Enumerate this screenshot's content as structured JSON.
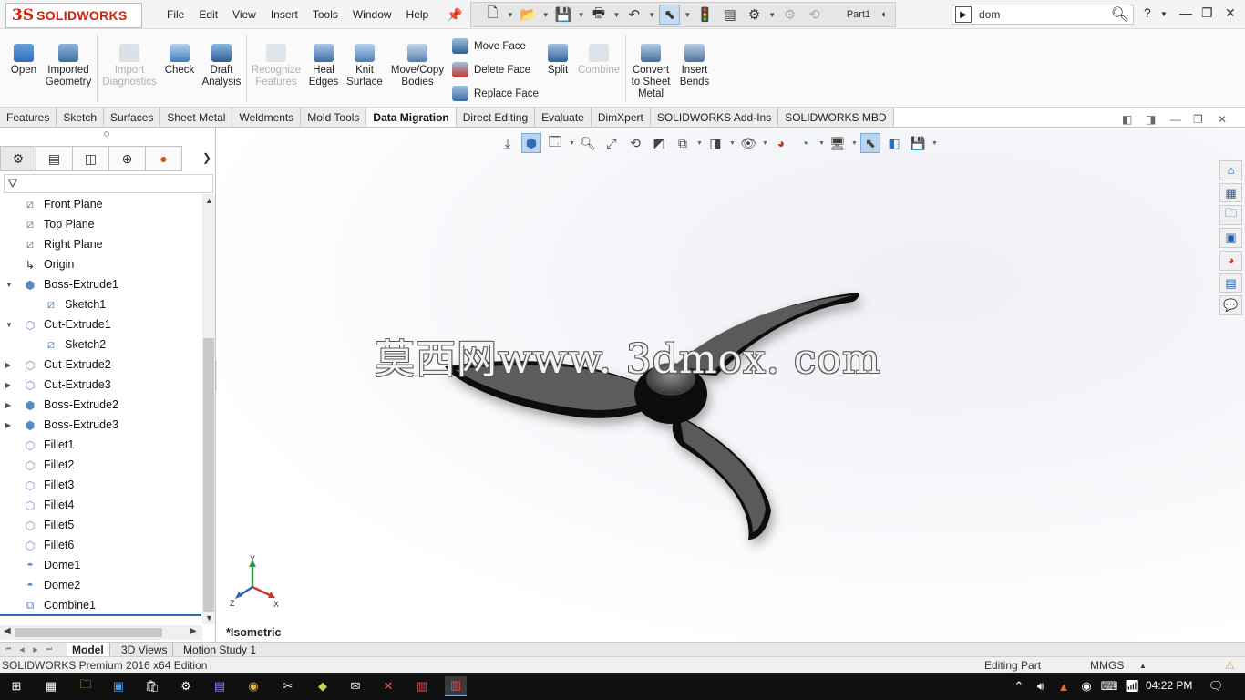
{
  "titlebar": {
    "brand": "SOLIDWORKS",
    "brand_prefix": "3S",
    "menu": [
      "File",
      "Edit",
      "View",
      "Insert",
      "Tools",
      "Window",
      "Help"
    ],
    "doc_name": "Part1",
    "search_value": "dom"
  },
  "ribbon": {
    "open": "Open",
    "imported_geometry_1": "Imported",
    "imported_geometry_2": "Geometry",
    "import_diag_1": "Import",
    "import_diag_2": "Diagnostics",
    "check": "Check",
    "draft_1": "Draft",
    "draft_2": "Analysis",
    "recognize_1": "Recognize",
    "recognize_2": "Features",
    "heal_1": "Heal",
    "heal_2": "Edges",
    "knit_1": "Knit",
    "knit_2": "Surface",
    "movecopy_1": "Move/Copy",
    "movecopy_2": "Bodies",
    "move_face": "Move Face",
    "delete_face": "Delete Face",
    "replace_face": "Replace Face",
    "split": "Split",
    "combine": "Combine",
    "convert_1": "Convert",
    "convert_2": "to Sheet",
    "convert_3": "Metal",
    "insert_bends_1": "Insert",
    "insert_bends_2": "Bends"
  },
  "tabs": [
    "Features",
    "Sketch",
    "Surfaces",
    "Sheet Metal",
    "Weldments",
    "Mold Tools",
    "Data Migration",
    "Direct Editing",
    "Evaluate",
    "DimXpert",
    "SOLIDWORKS Add-Ins",
    "SOLIDWORKS MBD"
  ],
  "active_tab": "Data Migration",
  "tree": [
    {
      "label": "Front Plane",
      "icon": "plane-icon",
      "indent": 0,
      "toggle": ""
    },
    {
      "label": "Top Plane",
      "icon": "plane-icon",
      "indent": 0,
      "toggle": ""
    },
    {
      "label": "Right Plane",
      "icon": "plane-icon",
      "indent": 0,
      "toggle": ""
    },
    {
      "label": "Origin",
      "icon": "origin-icon",
      "indent": 0,
      "toggle": ""
    },
    {
      "label": "Boss-Extrude1",
      "icon": "boss-extrude-icon",
      "indent": 0,
      "toggle": "expanded"
    },
    {
      "label": "Sketch1",
      "icon": "sketch-icon",
      "indent": 1,
      "toggle": ""
    },
    {
      "label": "Cut-Extrude1",
      "icon": "cut-extrude-icon",
      "indent": 0,
      "toggle": "expanded"
    },
    {
      "label": "Sketch2",
      "icon": "sketch-icon",
      "indent": 1,
      "toggle": ""
    },
    {
      "label": "Cut-Extrude2",
      "icon": "cut-extrude-icon",
      "indent": 0,
      "toggle": "collapsed"
    },
    {
      "label": "Cut-Extrude3",
      "icon": "cut-extrude-icon",
      "indent": 0,
      "toggle": "collapsed"
    },
    {
      "label": "Boss-Extrude2",
      "icon": "boss-extrude-icon",
      "indent": 0,
      "toggle": "collapsed"
    },
    {
      "label": "Boss-Extrude3",
      "icon": "boss-extrude-icon",
      "indent": 0,
      "toggle": "collapsed"
    },
    {
      "label": "Fillet1",
      "icon": "fillet-icon",
      "indent": 0,
      "toggle": ""
    },
    {
      "label": "Fillet2",
      "icon": "fillet-icon",
      "indent": 0,
      "toggle": ""
    },
    {
      "label": "Fillet3",
      "icon": "fillet-icon",
      "indent": 0,
      "toggle": ""
    },
    {
      "label": "Fillet4",
      "icon": "fillet-icon",
      "indent": 0,
      "toggle": ""
    },
    {
      "label": "Fillet5",
      "icon": "fillet-icon",
      "indent": 0,
      "toggle": ""
    },
    {
      "label": "Fillet6",
      "icon": "fillet-icon",
      "indent": 0,
      "toggle": ""
    },
    {
      "label": "Dome1",
      "icon": "dome-icon",
      "indent": 0,
      "toggle": ""
    },
    {
      "label": "Dome2",
      "icon": "dome-icon",
      "indent": 0,
      "toggle": ""
    },
    {
      "label": "Combine1",
      "icon": "combine-icon",
      "indent": 0,
      "toggle": ""
    }
  ],
  "viewport": {
    "watermark": "莫西网www. 3dmox. com",
    "view_name": "*Isometric",
    "triad_x": "X",
    "triad_y": "Y",
    "triad_z": "Z"
  },
  "bottom_tabs": [
    "Model",
    "3D Views",
    "Motion Study 1"
  ],
  "status": {
    "edition": "SOLIDWORKS Premium 2016 x64 Edition",
    "mode": "Editing Part",
    "units": "MMGS"
  },
  "taskbar": {
    "time": "04:22 PM"
  },
  "colors": {
    "brand_red": "#d81e05",
    "accent_blue": "#2f6db8",
    "model_gray": "#5a5a5a"
  }
}
